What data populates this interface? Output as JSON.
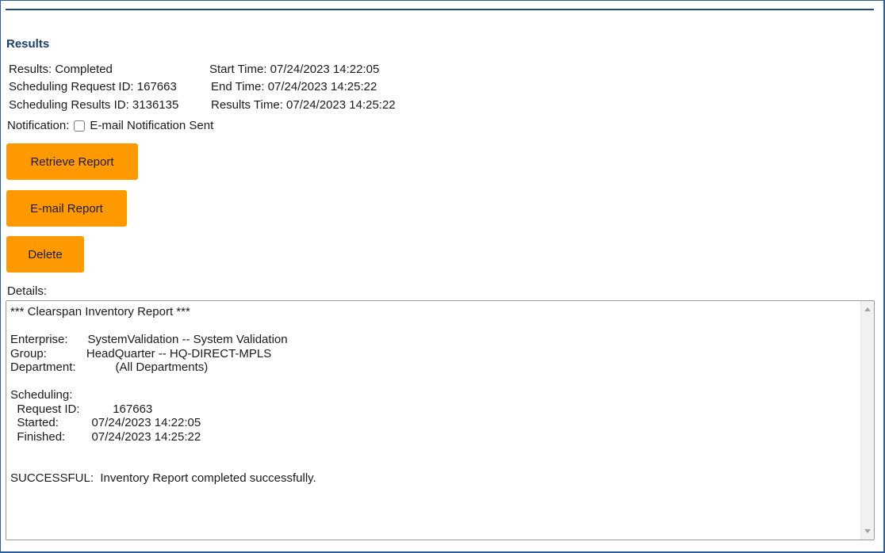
{
  "section_title": "Results",
  "info": {
    "results": "Results:  Completed",
    "request_id": "Scheduling Request ID:  167663",
    "results_id": "Scheduling Results ID:  3136135",
    "start_time": "Start Time:  07/24/2023 14:22:05",
    "end_time": "End Time:  07/24/2023 14:25:22",
    "results_time": "Results Time:  07/24/2023 14:25:22"
  },
  "notification": {
    "label": "Notification:",
    "checkbox_label": "E-mail Notification Sent",
    "checked": false
  },
  "buttons": {
    "retrieve": "Retrieve Report",
    "email": "E-mail Report",
    "delete": "Delete"
  },
  "details": {
    "label": "Details:",
    "text": "*** Clearspan Inventory Report ***\n\nEnterprise:      SystemValidation -- System Validation\nGroup:            HeadQuarter -- HQ-DIRECT-MPLS\nDepartment:            (All Departments)\n\nScheduling:\n  Request ID:          167663\n  Started:          07/24/2023 14:22:05\n  Finished:        07/24/2023 14:25:22\n\n\nSUCCESSFUL:  Inventory Report completed successfully."
  },
  "colors": {
    "button": "#ff9900",
    "title": "#1c3f6e",
    "rule": "#1e4d86"
  }
}
